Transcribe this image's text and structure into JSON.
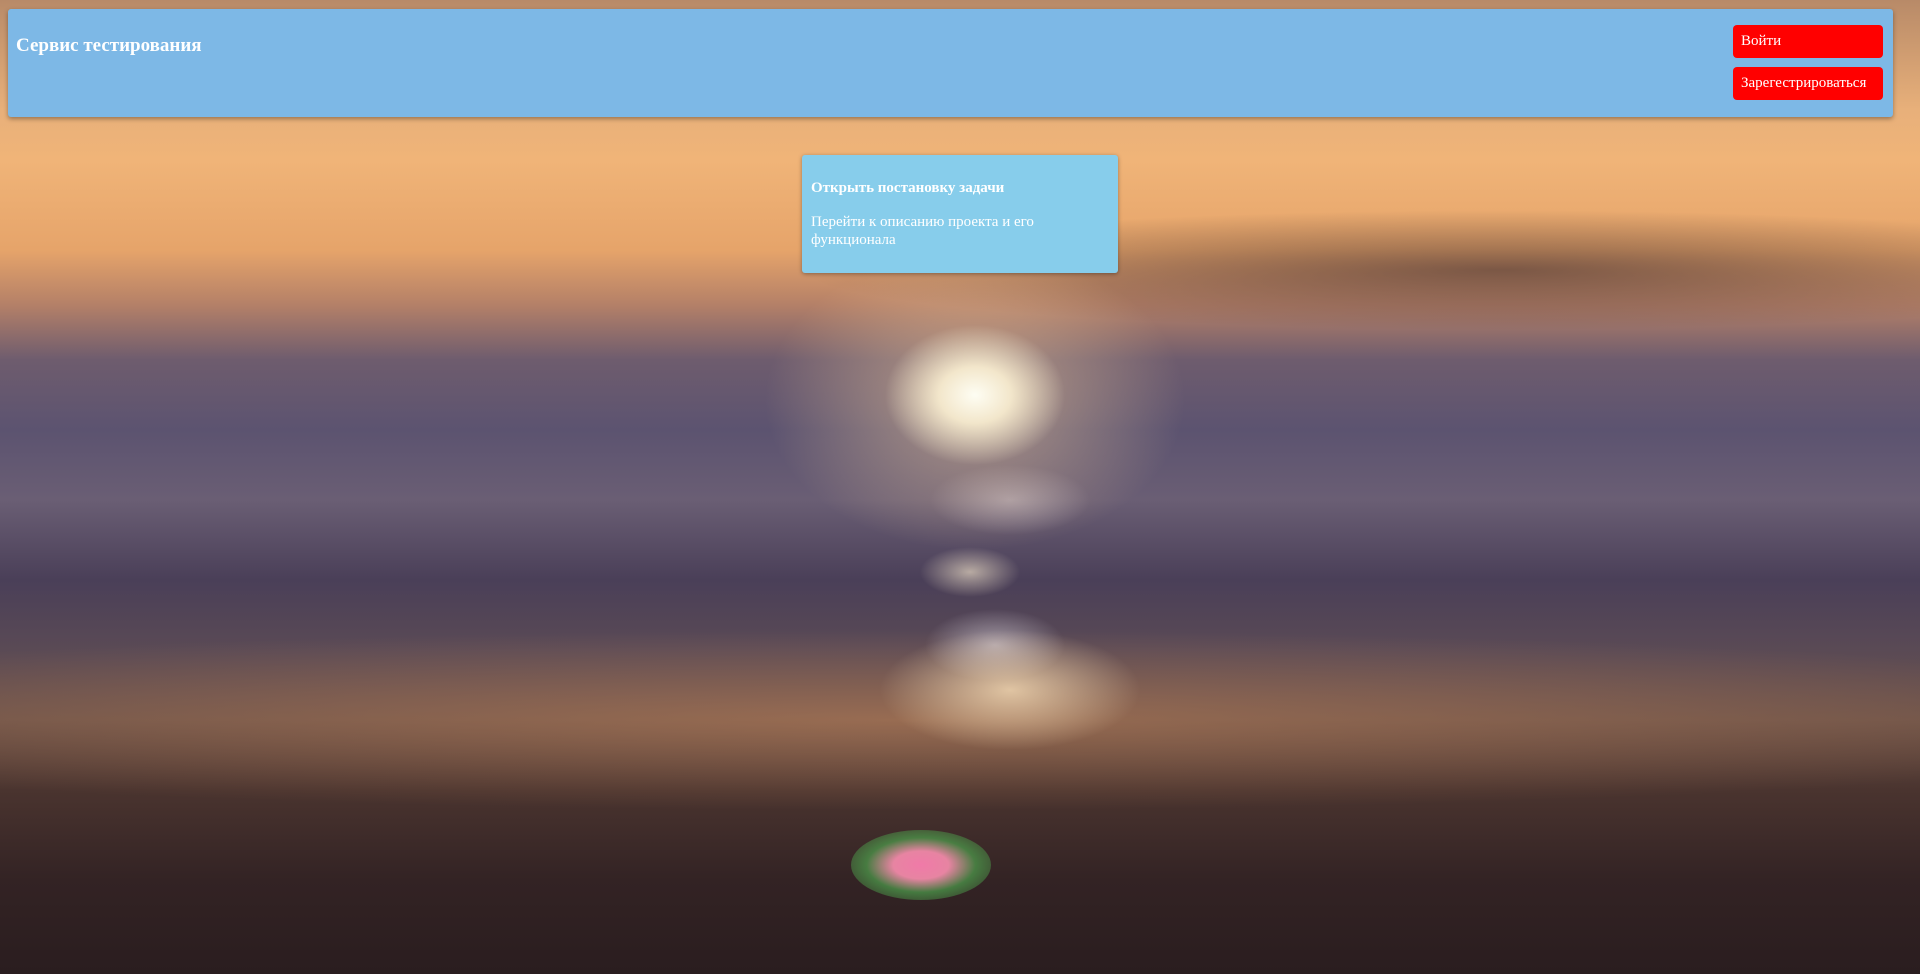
{
  "header": {
    "brand": "Сервис тестирования",
    "login_label": "Войти",
    "register_label": "Зарегестрироваться"
  },
  "card": {
    "title": "Открыть постановку задачи",
    "text": "Перейти к описанию проекта и его функционала"
  },
  "colors": {
    "header_bg": "#7db8e6",
    "button_bg": "#ff0000",
    "card_bg": "#87cdeb",
    "text": "#ffffff"
  }
}
